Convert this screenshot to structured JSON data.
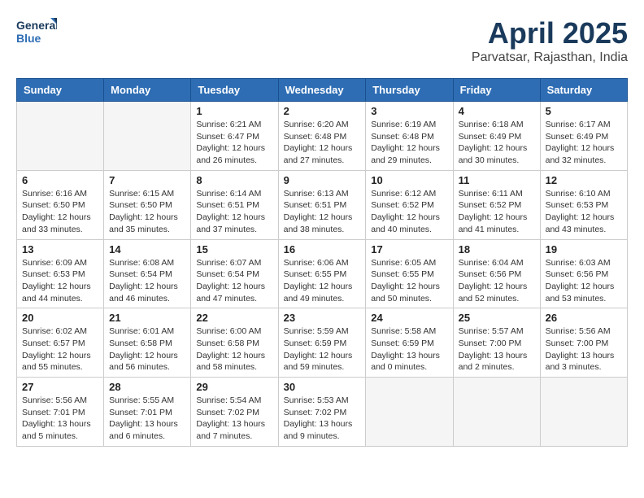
{
  "header": {
    "logo_line1": "General",
    "logo_line2": "Blue",
    "month_title": "April 2025",
    "location": "Parvatsar, Rajasthan, India"
  },
  "days_of_week": [
    "Sunday",
    "Monday",
    "Tuesday",
    "Wednesday",
    "Thursday",
    "Friday",
    "Saturday"
  ],
  "weeks": [
    [
      {
        "day": "",
        "info": ""
      },
      {
        "day": "",
        "info": ""
      },
      {
        "day": "1",
        "info": "Sunrise: 6:21 AM\nSunset: 6:47 PM\nDaylight: 12 hours and 26 minutes."
      },
      {
        "day": "2",
        "info": "Sunrise: 6:20 AM\nSunset: 6:48 PM\nDaylight: 12 hours and 27 minutes."
      },
      {
        "day": "3",
        "info": "Sunrise: 6:19 AM\nSunset: 6:48 PM\nDaylight: 12 hours and 29 minutes."
      },
      {
        "day": "4",
        "info": "Sunrise: 6:18 AM\nSunset: 6:49 PM\nDaylight: 12 hours and 30 minutes."
      },
      {
        "day": "5",
        "info": "Sunrise: 6:17 AM\nSunset: 6:49 PM\nDaylight: 12 hours and 32 minutes."
      }
    ],
    [
      {
        "day": "6",
        "info": "Sunrise: 6:16 AM\nSunset: 6:50 PM\nDaylight: 12 hours and 33 minutes."
      },
      {
        "day": "7",
        "info": "Sunrise: 6:15 AM\nSunset: 6:50 PM\nDaylight: 12 hours and 35 minutes."
      },
      {
        "day": "8",
        "info": "Sunrise: 6:14 AM\nSunset: 6:51 PM\nDaylight: 12 hours and 37 minutes."
      },
      {
        "day": "9",
        "info": "Sunrise: 6:13 AM\nSunset: 6:51 PM\nDaylight: 12 hours and 38 minutes."
      },
      {
        "day": "10",
        "info": "Sunrise: 6:12 AM\nSunset: 6:52 PM\nDaylight: 12 hours and 40 minutes."
      },
      {
        "day": "11",
        "info": "Sunrise: 6:11 AM\nSunset: 6:52 PM\nDaylight: 12 hours and 41 minutes."
      },
      {
        "day": "12",
        "info": "Sunrise: 6:10 AM\nSunset: 6:53 PM\nDaylight: 12 hours and 43 minutes."
      }
    ],
    [
      {
        "day": "13",
        "info": "Sunrise: 6:09 AM\nSunset: 6:53 PM\nDaylight: 12 hours and 44 minutes."
      },
      {
        "day": "14",
        "info": "Sunrise: 6:08 AM\nSunset: 6:54 PM\nDaylight: 12 hours and 46 minutes."
      },
      {
        "day": "15",
        "info": "Sunrise: 6:07 AM\nSunset: 6:54 PM\nDaylight: 12 hours and 47 minutes."
      },
      {
        "day": "16",
        "info": "Sunrise: 6:06 AM\nSunset: 6:55 PM\nDaylight: 12 hours and 49 minutes."
      },
      {
        "day": "17",
        "info": "Sunrise: 6:05 AM\nSunset: 6:55 PM\nDaylight: 12 hours and 50 minutes."
      },
      {
        "day": "18",
        "info": "Sunrise: 6:04 AM\nSunset: 6:56 PM\nDaylight: 12 hours and 52 minutes."
      },
      {
        "day": "19",
        "info": "Sunrise: 6:03 AM\nSunset: 6:56 PM\nDaylight: 12 hours and 53 minutes."
      }
    ],
    [
      {
        "day": "20",
        "info": "Sunrise: 6:02 AM\nSunset: 6:57 PM\nDaylight: 12 hours and 55 minutes."
      },
      {
        "day": "21",
        "info": "Sunrise: 6:01 AM\nSunset: 6:58 PM\nDaylight: 12 hours and 56 minutes."
      },
      {
        "day": "22",
        "info": "Sunrise: 6:00 AM\nSunset: 6:58 PM\nDaylight: 12 hours and 58 minutes."
      },
      {
        "day": "23",
        "info": "Sunrise: 5:59 AM\nSunset: 6:59 PM\nDaylight: 12 hours and 59 minutes."
      },
      {
        "day": "24",
        "info": "Sunrise: 5:58 AM\nSunset: 6:59 PM\nDaylight: 13 hours and 0 minutes."
      },
      {
        "day": "25",
        "info": "Sunrise: 5:57 AM\nSunset: 7:00 PM\nDaylight: 13 hours and 2 minutes."
      },
      {
        "day": "26",
        "info": "Sunrise: 5:56 AM\nSunset: 7:00 PM\nDaylight: 13 hours and 3 minutes."
      }
    ],
    [
      {
        "day": "27",
        "info": "Sunrise: 5:56 AM\nSunset: 7:01 PM\nDaylight: 13 hours and 5 minutes."
      },
      {
        "day": "28",
        "info": "Sunrise: 5:55 AM\nSunset: 7:01 PM\nDaylight: 13 hours and 6 minutes."
      },
      {
        "day": "29",
        "info": "Sunrise: 5:54 AM\nSunset: 7:02 PM\nDaylight: 13 hours and 7 minutes."
      },
      {
        "day": "30",
        "info": "Sunrise: 5:53 AM\nSunset: 7:02 PM\nDaylight: 13 hours and 9 minutes."
      },
      {
        "day": "",
        "info": ""
      },
      {
        "day": "",
        "info": ""
      },
      {
        "day": "",
        "info": ""
      }
    ]
  ]
}
